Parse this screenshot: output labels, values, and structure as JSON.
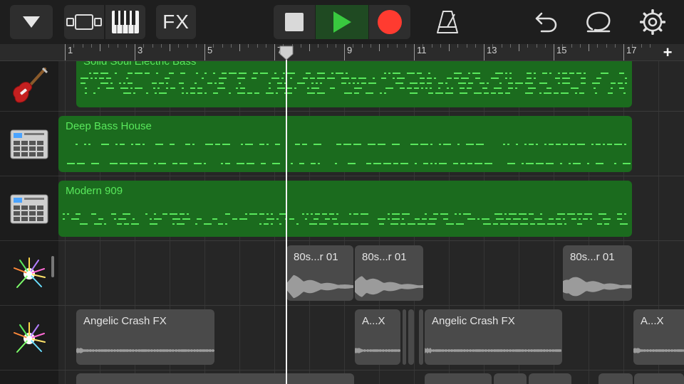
{
  "toolbar": {
    "fx_label": "FX"
  },
  "ruler": {
    "bar_labels": [
      "1",
      "3",
      "5",
      "7",
      "9",
      "11",
      "13",
      "15",
      "17"
    ],
    "add_label": "+"
  },
  "tracks": [
    {
      "instrument": "electric-bass-guitar",
      "regions": [
        {
          "name": "Solid Soul Electric Bass"
        }
      ]
    },
    {
      "instrument": "drum-machine",
      "regions": [
        {
          "name": "Deep Bass House"
        }
      ]
    },
    {
      "instrument": "drum-machine",
      "regions": [
        {
          "name": "Modern 909"
        }
      ]
    },
    {
      "instrument": "sparkle-fx",
      "regions": [
        {
          "name": "80s...r 01"
        },
        {
          "name": "80s...r 01"
        },
        {
          "name": "80s...r 01"
        }
      ]
    },
    {
      "instrument": "sparkle-fx",
      "regions": [
        {
          "name": "Angelic Crash FX"
        },
        {
          "name": "A...X"
        },
        {
          "name": "Angelic Crash FX"
        },
        {
          "name": "A...X"
        }
      ]
    }
  ],
  "colors": {
    "midi_region": "#1b6b1e",
    "midi_notes": "#59e85c",
    "audio_region": "#4a4a4a",
    "record": "#ff3b30",
    "play": "#39c93f"
  }
}
